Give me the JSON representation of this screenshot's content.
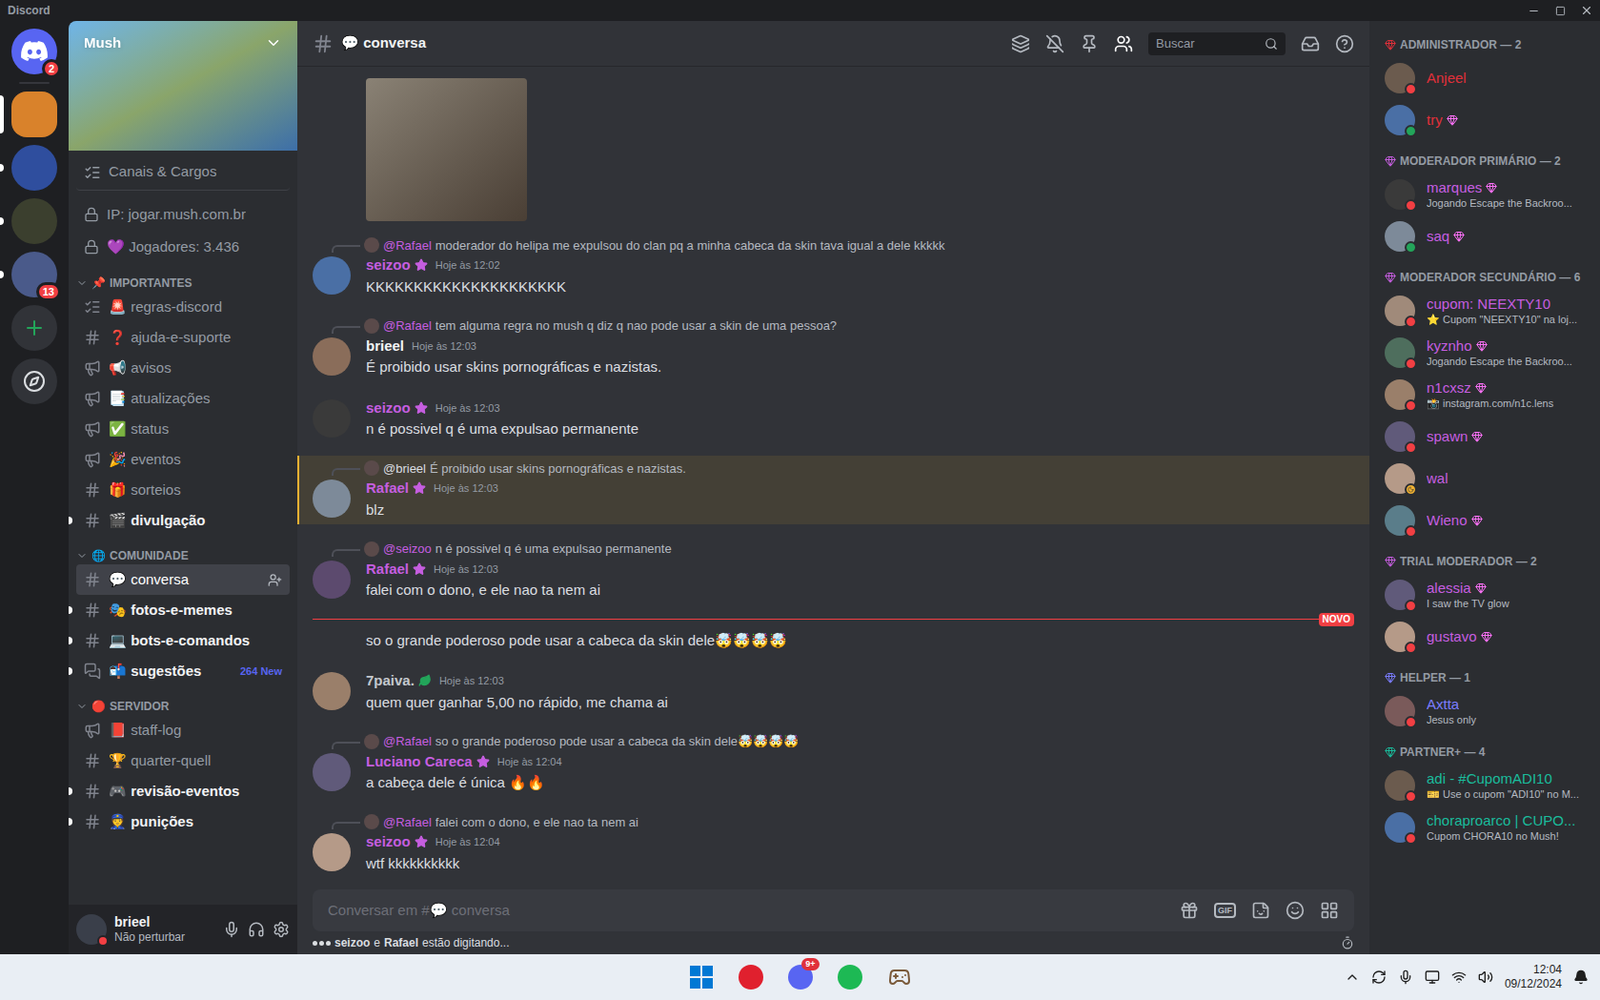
{
  "window": {
    "title": "Discord"
  },
  "servers": [
    {
      "kind": "home",
      "selected": false,
      "unread": false,
      "badge": "2",
      "color": "#5865f2"
    },
    {
      "kind": "server",
      "selected": true,
      "unread": false,
      "badge": "",
      "color": "#d9822b"
    },
    {
      "kind": "server",
      "selected": false,
      "unread": true,
      "badge": "",
      "color": "#2f4e9e"
    },
    {
      "kind": "server",
      "selected": false,
      "unread": true,
      "badge": "",
      "color": "#3b3f2e"
    },
    {
      "kind": "server",
      "selected": false,
      "unread": true,
      "badge": "13",
      "color": "#4a5a8a"
    },
    {
      "kind": "add",
      "selected": false,
      "unread": false,
      "badge": "",
      "color": "#313338"
    },
    {
      "kind": "explore",
      "selected": false,
      "unread": false,
      "badge": "",
      "color": "#313338"
    }
  ],
  "server": {
    "name": "Mush",
    "info": [
      {
        "kind": "roles",
        "text": "Canais & Cargos"
      },
      {
        "kind": "lock",
        "text": "IP: jogar.mush.com.br"
      },
      {
        "kind": "lock",
        "text": "💜 Jogadores: 3.436"
      }
    ],
    "categories": [
      {
        "icon": "📌",
        "name": "IMPORTANTES",
        "channels": [
          {
            "kind": "rules",
            "name": "🚨 regras-discord",
            "selected": false,
            "unread": false,
            "tag": ""
          },
          {
            "kind": "text",
            "name": "❓ ajuda-e-suporte",
            "selected": false,
            "unread": false,
            "tag": ""
          },
          {
            "kind": "announcement",
            "name": "📢 avisos",
            "selected": false,
            "unread": false,
            "tag": ""
          },
          {
            "kind": "announcement",
            "name": "📑 atualizações",
            "selected": false,
            "unread": false,
            "tag": ""
          },
          {
            "kind": "announcement",
            "name": "✅ status",
            "selected": false,
            "unread": false,
            "tag": ""
          },
          {
            "kind": "announcement",
            "name": "🎉 eventos",
            "selected": false,
            "unread": false,
            "tag": ""
          },
          {
            "kind": "text",
            "name": "🎁 sorteios",
            "selected": false,
            "unread": false,
            "tag": ""
          },
          {
            "kind": "text",
            "name": "🎬 divulgação",
            "selected": false,
            "unread": true,
            "tag": ""
          }
        ]
      },
      {
        "icon": "🌐",
        "name": "COMUNIDADE",
        "channels": [
          {
            "kind": "text",
            "name": "💬 conversa",
            "selected": true,
            "unread": false,
            "tag": ""
          },
          {
            "kind": "text",
            "name": "🎭 fotos-e-memes",
            "selected": false,
            "unread": true,
            "tag": ""
          },
          {
            "kind": "text",
            "name": "💻 bots-e-comandos",
            "selected": false,
            "unread": true,
            "tag": ""
          },
          {
            "kind": "forum",
            "name": "📬 sugestões",
            "selected": false,
            "unread": true,
            "tag": "264 New"
          }
        ]
      },
      {
        "icon": "🔴",
        "name": "SERVIDOR",
        "channels": [
          {
            "kind": "announcement",
            "name": "📕 staff-log",
            "selected": false,
            "unread": false,
            "tag": ""
          },
          {
            "kind": "text",
            "name": "🏆 quarter-quell",
            "selected": false,
            "unread": false,
            "tag": ""
          },
          {
            "kind": "text",
            "name": "🎮 revisão-eventos",
            "selected": false,
            "unread": true,
            "tag": ""
          },
          {
            "kind": "text",
            "name": "👮 punições",
            "selected": false,
            "unread": true,
            "tag": ""
          }
        ]
      }
    ]
  },
  "user": {
    "name": "brieel",
    "status": "Não perturbar"
  },
  "header": {
    "title": "💬 conversa",
    "search": "Buscar"
  },
  "messages": [
    {
      "kind": "attachment"
    },
    {
      "kind": "message",
      "reply": {
        "author": "@Rafael",
        "color": "#c65ee0",
        "text": "moderador do helipa me expulsou do clan pq a minha cabeca da skin tava igual a dele kkkkk"
      },
      "author": "seizoo",
      "color": "#c65ee0",
      "role_icon": "star",
      "time": "Hoje às 12:02",
      "text": "KKKKKKKKKKKKKKKKKKKKK",
      "mentioned": false
    },
    {
      "kind": "message",
      "reply": {
        "author": "@Rafael",
        "color": "#c65ee0",
        "text": "tem alguma regra no mush q diz q nao pode usar a skin de uma pessoa?"
      },
      "author": "brieel",
      "color": "#f2f3f5",
      "role_icon": "",
      "time": "Hoje às 12:03",
      "text": "É proibido usar skins pornográficas e nazistas.",
      "mentioned": false
    },
    {
      "kind": "message",
      "reply": null,
      "author": "seizoo",
      "color": "#c65ee0",
      "role_icon": "star",
      "time": "Hoje às 12:03",
      "text": "n é possivel q é uma expulsao permanente",
      "mentioned": false
    },
    {
      "kind": "message",
      "reply": {
        "author": "@brieel",
        "color": "#dbdee1",
        "text": "É proibido usar skins pornográficas e nazistas."
      },
      "author": "Rafael",
      "color": "#c65ee0",
      "role_icon": "star",
      "time": "Hoje às 12:03",
      "text": "blz",
      "mentioned": true
    },
    {
      "kind": "message",
      "reply": {
        "author": "@seizoo",
        "color": "#c65ee0",
        "text": "n é possivel q é uma expulsao permanente"
      },
      "author": "Rafael",
      "color": "#c65ee0",
      "role_icon": "star",
      "time": "Hoje às 12:03",
      "text": "falei com o dono, e ele nao ta nem ai",
      "mentioned": false
    },
    {
      "kind": "divider",
      "label": "NOVO"
    },
    {
      "kind": "continuation",
      "text": "so o grande poderoso pode usar a cabeca da skin dele🤯🤯🤯🤯"
    },
    {
      "kind": "message",
      "reply": null,
      "author": "7paiva.",
      "color": "#c4c9ce",
      "role_icon": "clover",
      "time": "Hoje às 12:03",
      "text": "quem quer ganhar 5,00 no rápido, me chama ai",
      "mentioned": false
    },
    {
      "kind": "message",
      "reply": {
        "author": "@Rafael",
        "color": "#c65ee0",
        "text": "so o grande poderoso pode usar a cabeca da skin dele🤯🤯🤯🤯"
      },
      "author": "Luciano Careca",
      "color": "#c65ee0",
      "role_icon": "star",
      "time": "Hoje às 12:04",
      "text": "a cabeça dele é única 🔥🔥",
      "mentioned": false
    },
    {
      "kind": "message",
      "reply": {
        "author": "@Rafael",
        "color": "#c65ee0",
        "text": "falei com o dono, e ele nao ta nem ai"
      },
      "author": "seizoo",
      "color": "#c65ee0",
      "role_icon": "star",
      "time": "Hoje às 12:04",
      "text": "wtf kkkkkkkkkk",
      "mentioned": false
    }
  ],
  "input": {
    "placeholder": "Conversar em #💬 conversa",
    "gif": "GIF"
  },
  "typing": {
    "users": [
      "seizoo",
      "Rafael"
    ],
    "joiner": "e",
    "suffix": "estão digitando..."
  },
  "member_groups": [
    {
      "title": "ADMINISTRADOR — 2",
      "color": "#e0303a",
      "members": [
        {
          "name": "Anjeel",
          "activity": "",
          "status": "dnd",
          "booster": false
        },
        {
          "name": "try",
          "activity": "",
          "status": "online",
          "booster": true
        }
      ]
    },
    {
      "title": "MODERADOR PRIMÁRIO — 2",
      "color": "#c65ee0",
      "members": [
        {
          "name": "marques",
          "activity": "Jogando Escape the Backroo...",
          "status": "dnd",
          "booster": true
        },
        {
          "name": "saq",
          "activity": "",
          "status": "online",
          "booster": true
        }
      ]
    },
    {
      "title": "MODERADOR SECUNDÁRIO — 6",
      "color": "#c65ee0",
      "members": [
        {
          "name": "cupom: NEEXTY10",
          "activity": "⭐ Cupom \"NEEXTY10\" na loj...",
          "status": "dnd",
          "booster": false
        },
        {
          "name": "kyznho",
          "activity": "Jogando Escape the Backroo...",
          "status": "dnd",
          "booster": true
        },
        {
          "name": "n1cxsz",
          "activity": "📸 instagram.com/n1c.lens",
          "status": "dnd",
          "booster": true
        },
        {
          "name": "spawn",
          "activity": "",
          "status": "dnd",
          "booster": true
        },
        {
          "name": "wal",
          "activity": "",
          "status": "idle",
          "booster": false
        },
        {
          "name": "Wieno",
          "activity": "",
          "status": "dnd",
          "booster": true
        }
      ]
    },
    {
      "title": "TRIAL MODERADOR — 2",
      "color": "#c65ee0",
      "members": [
        {
          "name": "alessia",
          "activity": "I saw the TV glow",
          "status": "dnd",
          "booster": true
        },
        {
          "name": "gustavo",
          "activity": "",
          "status": "dnd",
          "booster": true
        }
      ]
    },
    {
      "title": "HELPER — 1",
      "color": "#7b7dff",
      "members": [
        {
          "name": "Axtta",
          "activity": "Jesus only",
          "status": "dnd",
          "booster": false
        }
      ]
    },
    {
      "title": "PARTNER+ — 4",
      "color": "#1abc9c",
      "members": [
        {
          "name": "adi - #CupomADI10",
          "activity": "🎫 Use o cupom \"ADI10\" no M...",
          "status": "dnd",
          "booster": false
        },
        {
          "name": "choraproarco | CUPO...",
          "activity": "Cupom CHORA10 no Mush!",
          "status": "dnd",
          "booster": false
        }
      ]
    }
  ],
  "taskbar": {
    "apps": [
      {
        "kind": "start",
        "badge": "",
        "color": "#0078d4"
      },
      {
        "kind": "opera",
        "badge": "",
        "color": "#e0202e"
      },
      {
        "kind": "discord",
        "badge": "9+",
        "color": "#5865f2"
      },
      {
        "kind": "spotify",
        "badge": "",
        "color": "#1db954"
      },
      {
        "kind": "minecraft",
        "badge": "",
        "color": "#7a5a3a"
      }
    ],
    "time": "12:04",
    "date": "09/12/2024"
  }
}
